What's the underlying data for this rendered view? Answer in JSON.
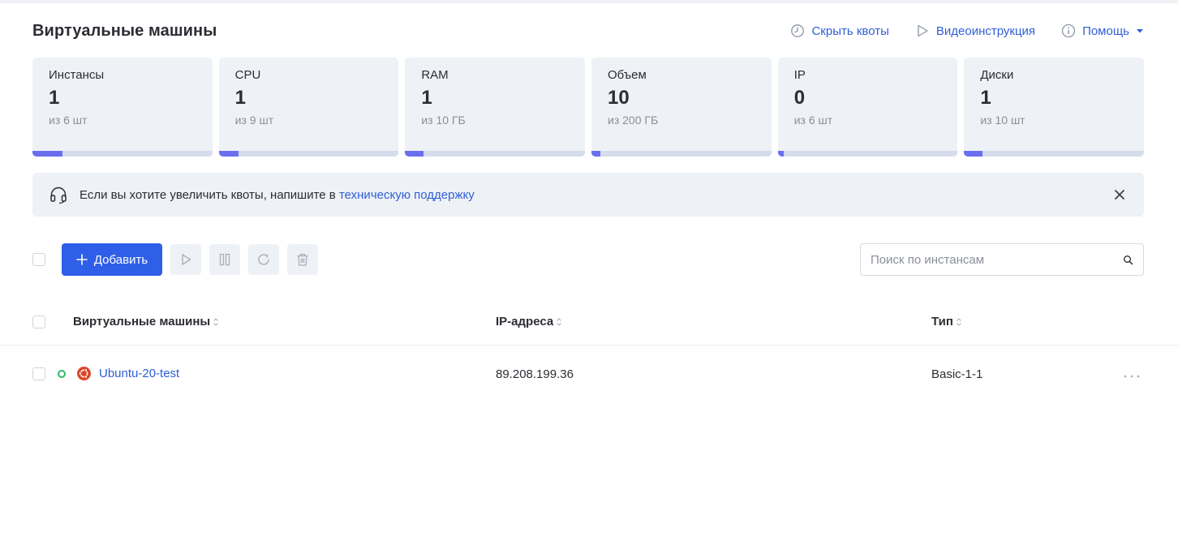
{
  "header": {
    "title": "Виртуальные машины",
    "hide_quotas_label": "Скрыть квоты",
    "video_label": "Видеоинструкция",
    "help_label": "Помощь"
  },
  "quotas": [
    {
      "name": "Инстансы",
      "value": "1",
      "limit": "из 6 шт",
      "fill_fraction": 0.167
    },
    {
      "name": "CPU",
      "value": "1",
      "limit": "из 9 шт",
      "fill_fraction": 0.111
    },
    {
      "name": "RAM",
      "value": "1",
      "limit": "из 10 ГБ",
      "fill_fraction": 0.1
    },
    {
      "name": "Объем",
      "value": "10",
      "limit": "из 200 ГБ",
      "fill_fraction": 0.05
    },
    {
      "name": "IP",
      "value": "0",
      "limit": "из 6 шт",
      "fill_fraction": 0.0
    },
    {
      "name": "Диски",
      "value": "1",
      "limit": "из 10 шт",
      "fill_fraction": 0.1
    }
  ],
  "notice": {
    "text": "Если вы хотите увеличить квоты, напишите в ",
    "link": "техническую поддержку"
  },
  "toolbar": {
    "add_label": "Добавить",
    "search_placeholder": "Поиск по инстансам"
  },
  "table": {
    "columns": [
      "Виртуальные машины",
      "IP-адреса",
      "Тип"
    ],
    "rows": [
      {
        "name": "Ubuntu-20-test",
        "ip": "89.208.199.36",
        "type": "Basic-1-1",
        "status": "running",
        "os_icon": "ubuntu-icon"
      }
    ]
  },
  "colors": {
    "accent": "#2f5fe8",
    "link": "#2f5fd6",
    "quota_fill": "#6a6ff0",
    "status_running": "#31b86a",
    "ubuntu": "#d9482b"
  }
}
